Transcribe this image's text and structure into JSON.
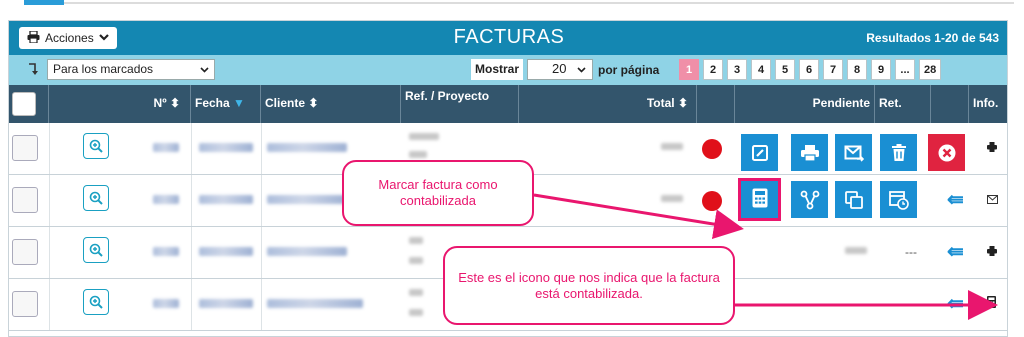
{
  "header": {
    "actions_label": "Acciones",
    "title": "FACTURAS",
    "results": "Resultados 1-20 de 543"
  },
  "toolbar": {
    "bulk_select_value": "Para los marcados",
    "show_label": "Mostrar",
    "per_page_value": "20",
    "per_page_label": "por página",
    "pages": [
      "1",
      "2",
      "3",
      "4",
      "5",
      "6",
      "7",
      "8",
      "9",
      "...",
      "28"
    ],
    "active_page": "1"
  },
  "columns": {
    "number": "Nº",
    "date": "Fecha",
    "client": "Cliente",
    "ref": "Ref. / Proyecto",
    "total": "Total",
    "pending": "Pendiente",
    "ret": "Ret.",
    "info": "Info."
  },
  "rows": [
    {
      "pending_status": "red",
      "info_icon": "printer-icon"
    },
    {
      "pending_status": "red",
      "info_icon": "envelope-icon"
    },
    {
      "pending_status": "",
      "ret": "---",
      "info_icon": "printer-icon"
    },
    {
      "pending_status": "",
      "info_icon": "calculator-icon"
    }
  ],
  "actions_popup": {
    "row1": [
      "edit-icon",
      "print-icon",
      "send-email-icon",
      "trash-icon",
      "cancel-icon"
    ],
    "row2": [
      "calculator-icon",
      "split-icon",
      "duplicate-icon",
      "schedule-icon"
    ]
  },
  "annotations": {
    "callout_mark": "Marcar factura como contabilizada",
    "callout_icon": "Este es el icono que nos indica que la factura está contabilizada."
  },
  "colors": {
    "header_blue": "#1487b2",
    "toolbar_cyan": "#8fd3e6",
    "column_header": "#33556c",
    "action_blue": "#1a8fd3",
    "cancel_red": "#e02340",
    "status_red": "#e0101a",
    "annotation_pink": "#e9166e",
    "active_page_pink": "#f08fa8"
  }
}
